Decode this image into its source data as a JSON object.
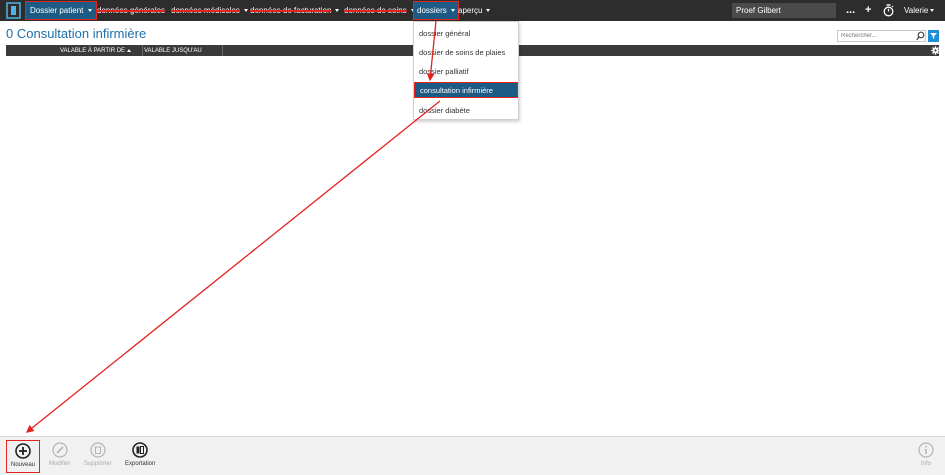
{
  "topbar": {
    "patient_button": "Dossier patient",
    "nav": [
      {
        "label": "données générales"
      },
      {
        "label": "données médicales"
      },
      {
        "label": "données de facturation"
      },
      {
        "label": "données de soins"
      },
      {
        "label": "dossiers"
      },
      {
        "label": "aperçu"
      }
    ],
    "patient_search_value": "Proef Gilbert",
    "more_label": "...",
    "add_label": "+",
    "user_name": "Valerie"
  },
  "page": {
    "title": "0 Consultation infirmière",
    "search_placeholder": "Rechercher..."
  },
  "table": {
    "columns": [
      {
        "label": "VALABLE À PARTIR DE"
      },
      {
        "label": "VALABLE JUSQU'AU"
      }
    ]
  },
  "dropdown": {
    "items": [
      {
        "label": "dossier général"
      },
      {
        "label": "dossier de soins de plaies"
      },
      {
        "label": "dossier palliatif"
      },
      {
        "label": "consultation infirmière"
      },
      {
        "label": "dossier diabète"
      }
    ]
  },
  "toolbar": {
    "buttons": [
      {
        "label": "Nouveau",
        "icon": "plus-circle-icon"
      },
      {
        "label": "Modifier",
        "icon": "pencil-icon"
      },
      {
        "label": "Supprimer",
        "icon": "trash-icon"
      },
      {
        "label": "Exportation",
        "icon": "export-icon"
      },
      {
        "label": "Info",
        "icon": "info-icon"
      }
    ]
  },
  "colors": {
    "topbar": "#2d2d2d",
    "accent": "#1e5b84",
    "title": "#1e6fa8",
    "annotation": "#e2241f"
  }
}
